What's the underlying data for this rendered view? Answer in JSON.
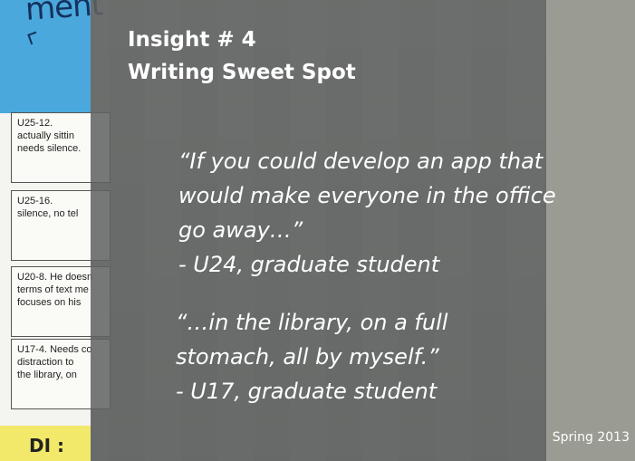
{
  "slide": {
    "title_line1": "Insight # 4",
    "title_line2": "Writing Sweet Spot",
    "footer": "Spring 2013"
  },
  "quotes": [
    {
      "lines": [
        "“If you could develop an app that",
        "would make everyone in the office",
        "go away…”"
      ],
      "attribution": "- U24, graduate student"
    },
    {
      "lines": [
        "“…in the library, on a full",
        "stomach, all by myself.”"
      ],
      "attribution": "- U17, graduate student"
    }
  ],
  "background": {
    "blue_note_text": "ment",
    "yellow_note_text": "DI :",
    "cards": [
      {
        "lines": [
          "U25-12.",
          "actually sittin",
          "needs silence."
        ]
      },
      {
        "lines": [
          "U25-16.",
          "silence, no tel"
        ]
      },
      {
        "lines": [
          "U20-8. He doesn",
          "terms of text me",
          "focuses on his"
        ]
      },
      {
        "lines": [
          "U17-4. Needs co",
          "distraction to",
          "the library, on"
        ]
      }
    ],
    "colors": {
      "overlay": "#5f6262",
      "blue_note": "#4aa8dc",
      "yellow_note": "#f2e96a"
    }
  }
}
